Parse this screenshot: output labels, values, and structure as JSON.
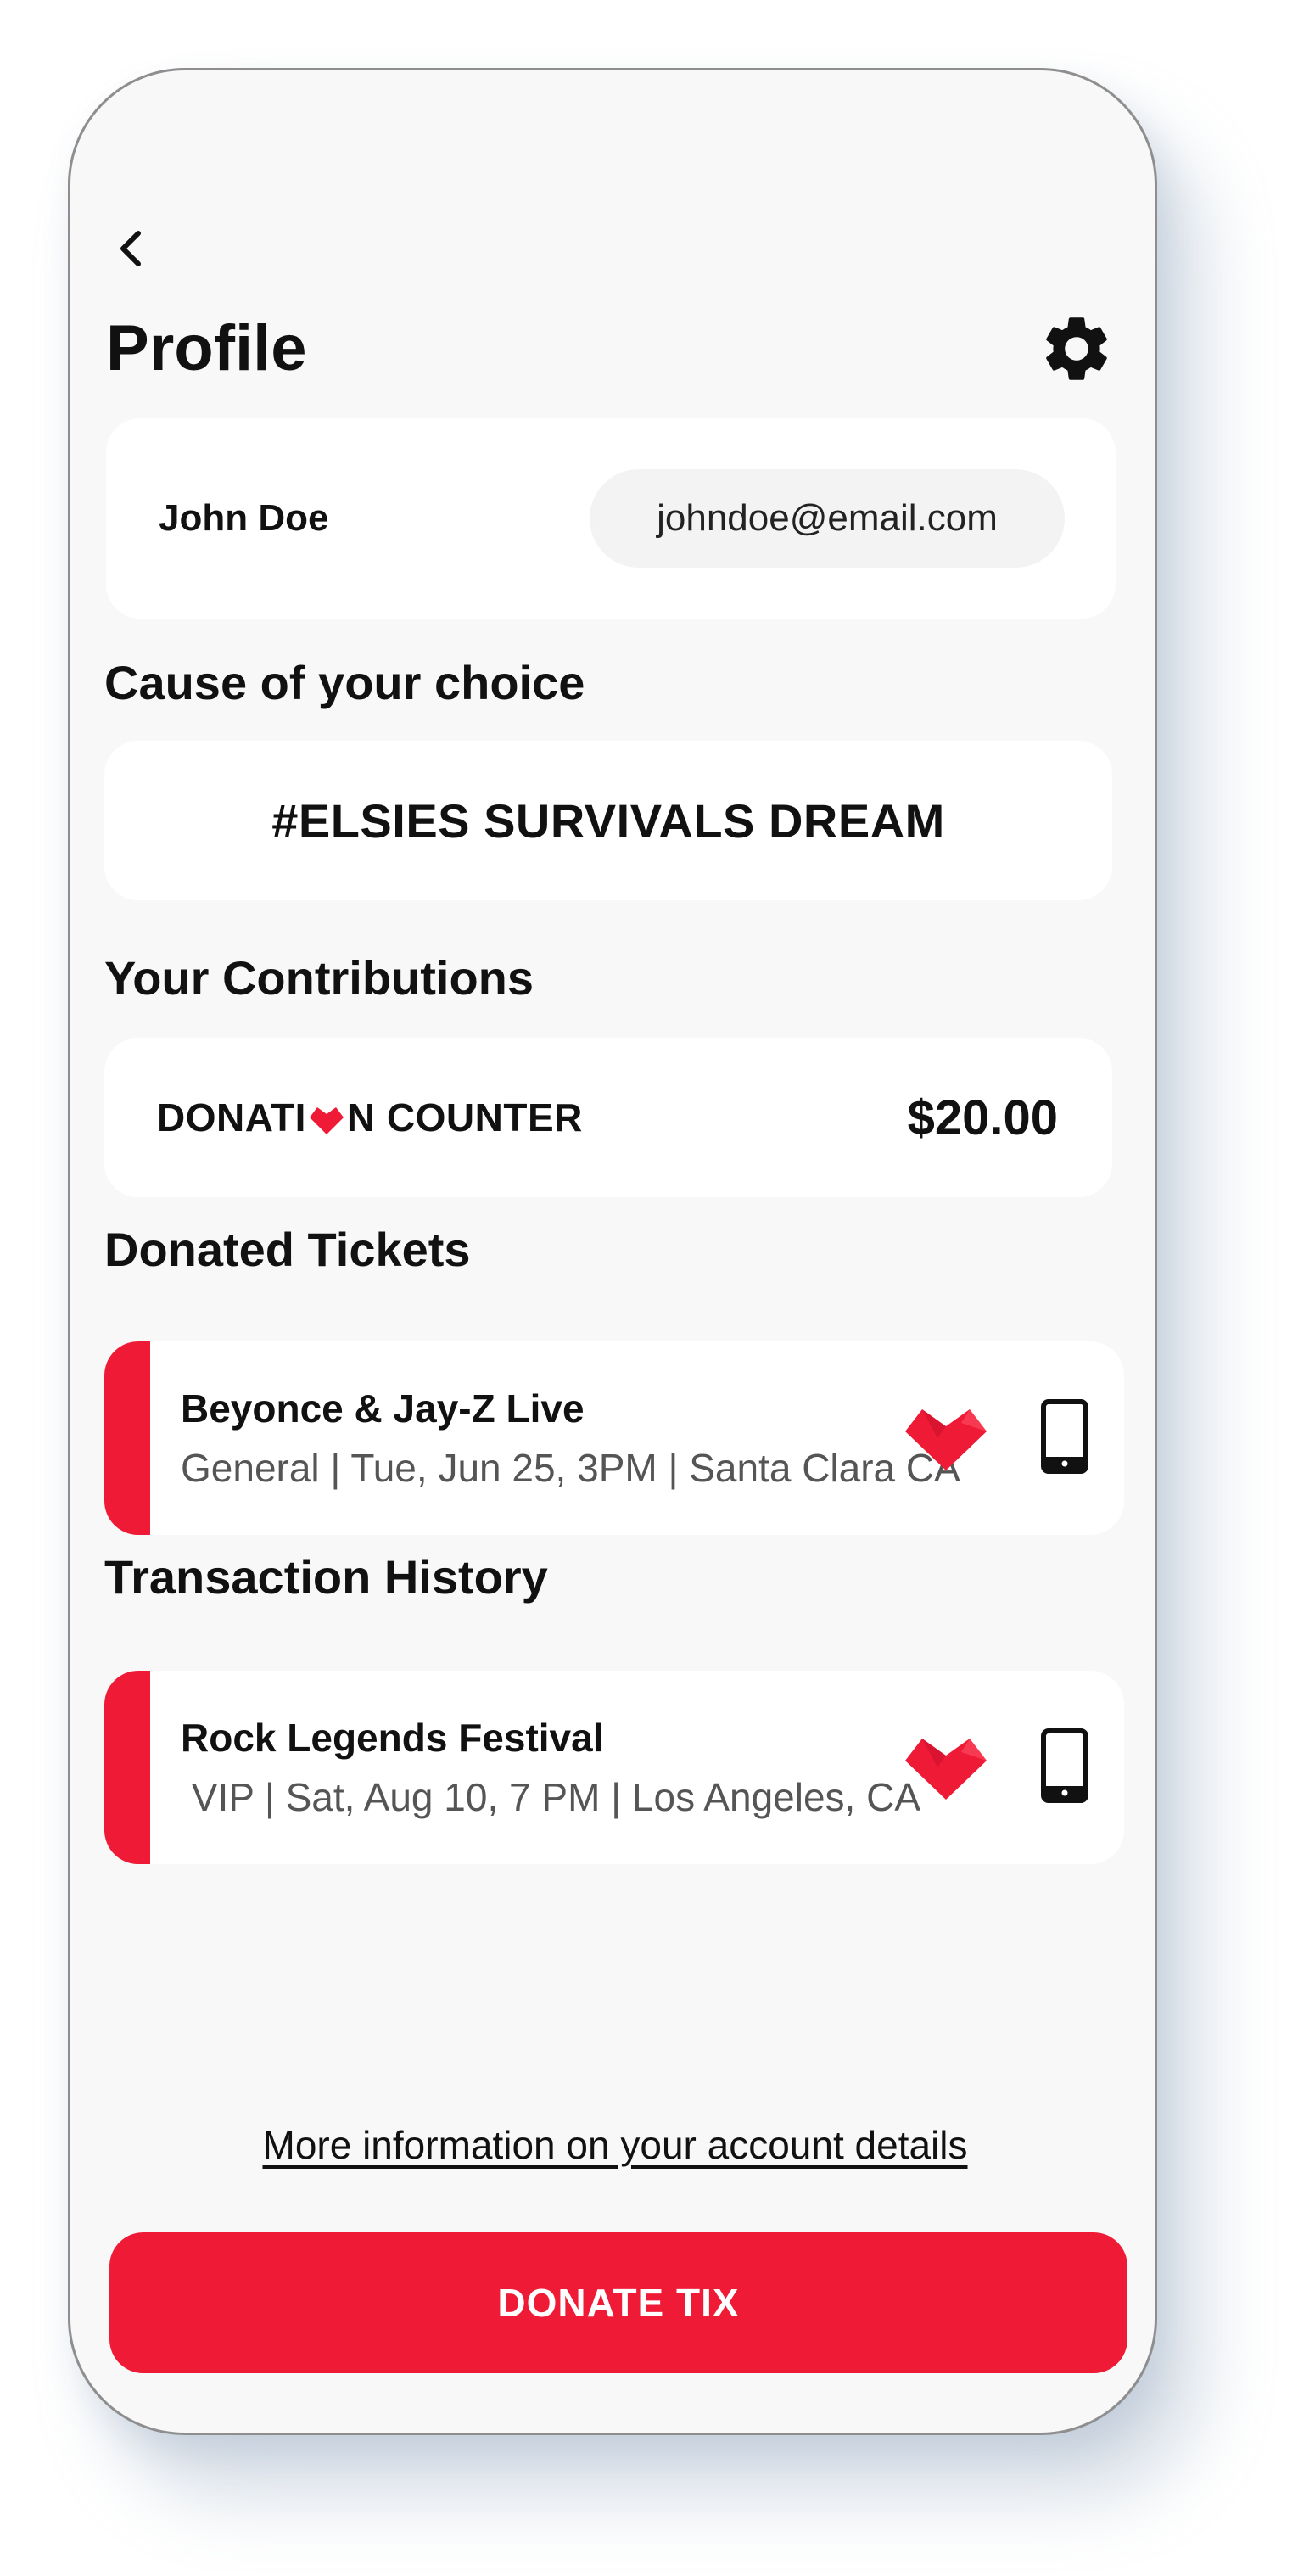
{
  "header": {
    "title": "Profile",
    "back_icon": "chevron-left-icon",
    "settings_icon": "gear-icon"
  },
  "user": {
    "name": "John Doe",
    "email": "johndoe@email.com"
  },
  "cause": {
    "heading": "Cause of your choice",
    "name": "#ELSIES SURVIVALS DREAM"
  },
  "contributions": {
    "heading": "Your Contributions",
    "counter_label_before": "DONATI",
    "counter_label_after": "N COUNTER",
    "amount": "$20.00"
  },
  "donated_tickets": {
    "heading": "Donated Tickets",
    "items": [
      {
        "title": "Beyonce & Jay-Z Live",
        "details": "General | Tue, Jun 25, 3PM | Santa Clara CA"
      }
    ]
  },
  "transaction_history": {
    "heading": "Transaction History",
    "items": [
      {
        "title": "Rock Legends Festival",
        "details": " VIP | Sat, Aug 10, 7 PM | Los Angeles, CA"
      }
    ]
  },
  "footer": {
    "account_link": "More information on your account details",
    "donate_button": "DONATE TIX"
  },
  "colors": {
    "accent": "#ef1a35",
    "background": "#f8f8f8",
    "card": "#ffffff",
    "text": "#111111",
    "muted_text": "#555555"
  }
}
